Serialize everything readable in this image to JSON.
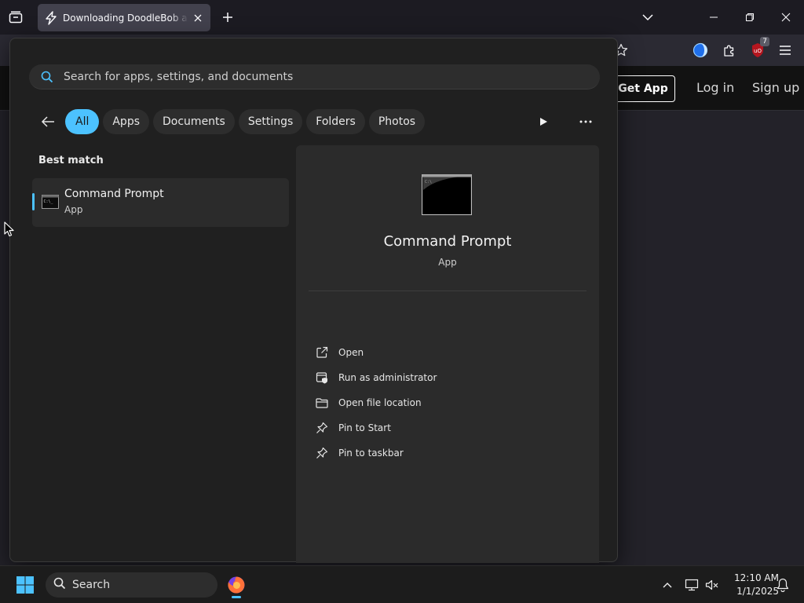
{
  "browser": {
    "tab": {
      "title": "Downloading DoodleBob and t"
    },
    "extensions_badge": "7"
  },
  "site": {
    "get_app": "Get App",
    "log_in": "Log in",
    "sign_up": "Sign up"
  },
  "search": {
    "placeholder": "Search for apps, settings, and documents",
    "filters": [
      "All",
      "Apps",
      "Documents",
      "Settings",
      "Folders",
      "Photos"
    ],
    "best_match_label": "Best match",
    "result": {
      "name": "Command Prompt",
      "type": "App"
    },
    "preview": {
      "name": "Command Prompt",
      "type": "App",
      "actions": [
        "Open",
        "Run as administrator",
        "Open file location",
        "Pin to Start",
        "Pin to taskbar"
      ]
    }
  },
  "taskbar": {
    "search_label": "Search",
    "time": "12:10 AM",
    "date": "1/1/2025"
  },
  "colors": {
    "accent": "#4cc2ff",
    "panel": "#202020",
    "card": "#2b2b2b"
  }
}
